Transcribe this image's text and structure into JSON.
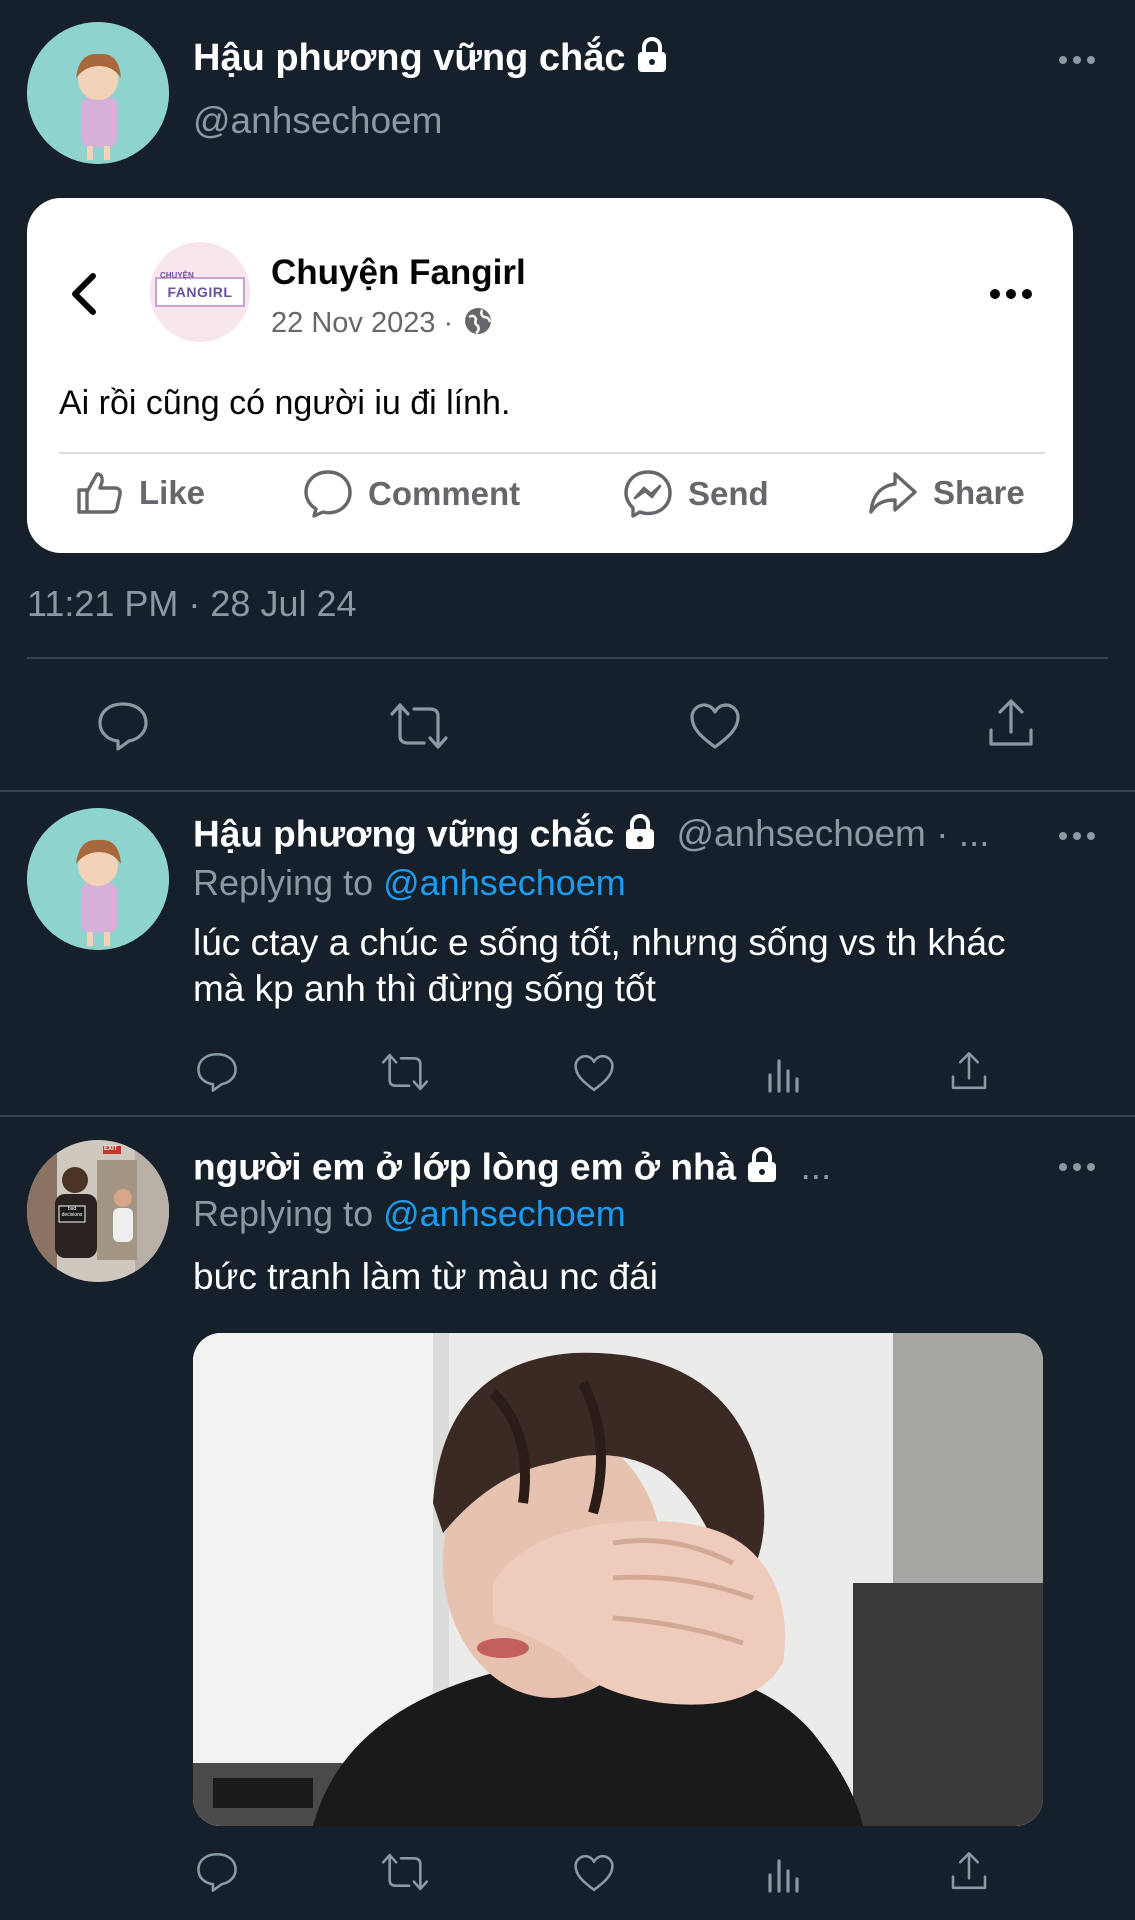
{
  "main_tweet": {
    "display_name": "Hậu phương vững chắc",
    "handle": "@anhsechoem",
    "timestamp": "11:21 PM · 28 Jul 24",
    "embedded_post": {
      "page_name": "Chuyện Fangirl",
      "date": "22 Nov 2023 ·",
      "logo_top_text": "CHUYỆN",
      "logo_text": "FANGIRL",
      "text": "Ai rồi cũng có người iu đi lính.",
      "actions": {
        "like": "Like",
        "comment": "Comment",
        "send": "Send",
        "share": "Share"
      }
    }
  },
  "replies": [
    {
      "display_name": "Hậu phương vững chắc",
      "handle": "@anhsechoem · ...",
      "replying_prefix": "Replying to ",
      "replying_to": "@anhsechoem",
      "text_line1": "lúc ctay a chúc e sống tốt, nhưng sống vs th khác",
      "text_line2": "mà kp anh thì đừng sống tốt"
    },
    {
      "display_name": "người em ở lớp lòng em ở nhà",
      "handle": "...",
      "replying_prefix": "Replying to ",
      "replying_to": "@anhsechoem",
      "text_line1": "bức tranh làm từ màu nc đái",
      "avatar_sign_left": "bad decisions",
      "avatar_exit_sign": "EXIT"
    }
  ],
  "icons": {
    "reply": "reply-icon",
    "retweet": "retweet-icon",
    "like": "heart-icon",
    "analytics": "analytics-icon",
    "share": "share-icon",
    "lock": "lock-icon",
    "more": "more-icon"
  },
  "colors": {
    "background": "#15202b",
    "muted": "#8b98a5",
    "link": "#1d9bf0",
    "separator": "#38444d"
  }
}
